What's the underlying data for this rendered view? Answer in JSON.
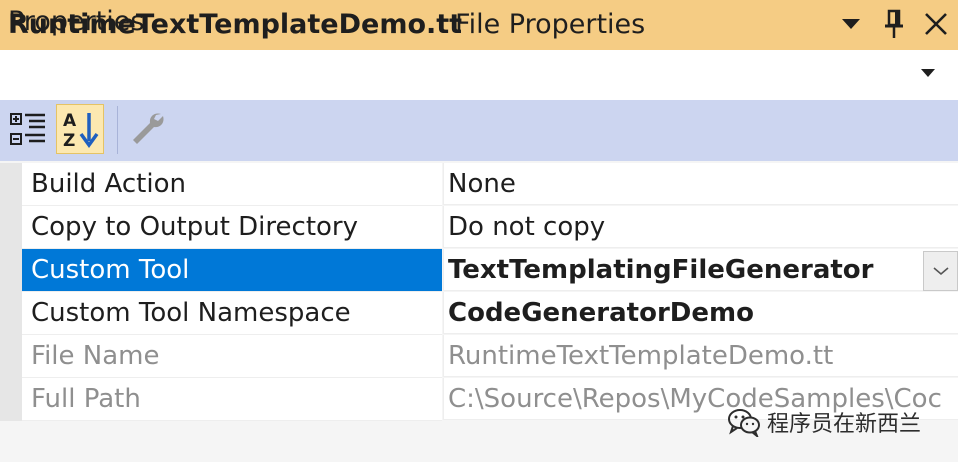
{
  "panel": {
    "title": "Properties"
  },
  "window_buttons": [
    "dropdown-arrow-icon",
    "pin-icon",
    "close-icon"
  ],
  "selector": {
    "object_name": "RuntimeTextTemplateDemo.tt",
    "object_type": "File Properties"
  },
  "toolbar": {
    "items": [
      {
        "icon": "categorized-icon",
        "active": false
      },
      {
        "icon": "alphabetical-sort-icon",
        "active": true
      },
      {
        "icon": "wrench-icon",
        "active": false,
        "enabled": false
      }
    ]
  },
  "properties": [
    {
      "name": "Build Action",
      "value": "None"
    },
    {
      "name": "Copy to Output Directory",
      "value": "Do not copy"
    },
    {
      "name": "Custom Tool",
      "value": "TextTemplatingFileGenerator"
    },
    {
      "name": "Custom Tool Namespace",
      "value": "CodeGeneratorDemo"
    },
    {
      "name": "File Name",
      "value": "RuntimeTextTemplateDemo.tt"
    },
    {
      "name": "Full Path",
      "value": "C:\\Source\\Repos\\MyCodeSamples\\Coc"
    }
  ],
  "watermark": {
    "text": "程序员在新西兰"
  },
  "colors": {
    "title_bar": "#f5cc84",
    "toolbar": "#ccd5f0",
    "selection": "#0078d7",
    "readonly_text": "#8f8f8f"
  }
}
